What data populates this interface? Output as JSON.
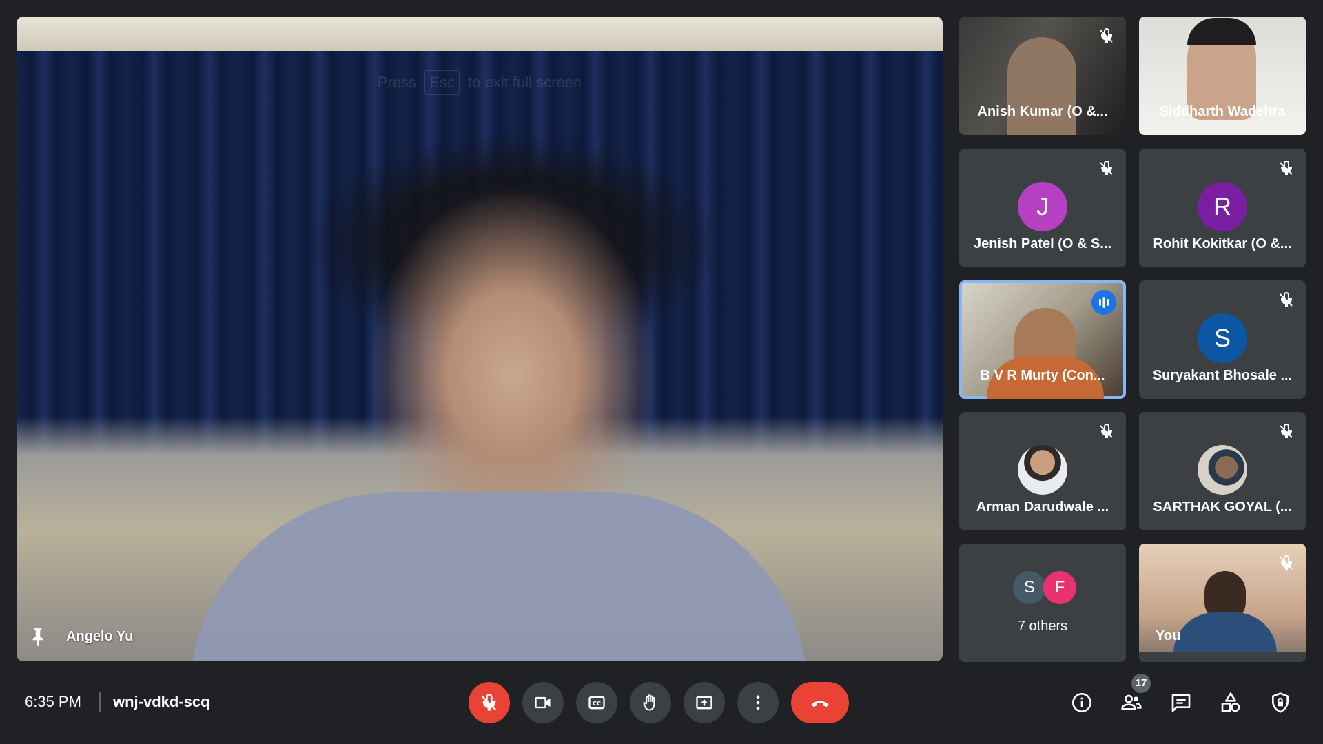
{
  "main": {
    "name": "Angelo Yu",
    "esc_hint_prefix": "Press",
    "esc_hint_key": "Esc",
    "esc_hint_suffix": "to exit full screen"
  },
  "participants": [
    {
      "name": "Anish Kumar (O &...",
      "type": "video",
      "muted": true
    },
    {
      "name": "Siddharth Wadehra",
      "type": "video",
      "muted": false
    },
    {
      "name": "Jenish Patel (O & S...",
      "type": "avatar",
      "initial": "J",
      "color": "#b541c2",
      "muted": true
    },
    {
      "name": "Rohit Kokitkar (O &...",
      "type": "avatar",
      "initial": "R",
      "color": "#7b1fa2",
      "muted": true
    },
    {
      "name": "B V R Murty (Con...",
      "type": "video",
      "muted": false,
      "speaking": true
    },
    {
      "name": "Suryakant Bhosale ...",
      "type": "avatar",
      "initial": "S",
      "color": "#0b57a4",
      "muted": true
    },
    {
      "name": "Arman Darudwale ...",
      "type": "photo",
      "muted": true
    },
    {
      "name": "SARTHAK GOYAL (...",
      "type": "photo",
      "muted": true
    },
    {
      "name": "You",
      "type": "video",
      "muted": true
    }
  ],
  "others": {
    "label": "7 others",
    "avatars": [
      {
        "initial": "S",
        "color": "#455a64"
      },
      {
        "initial": "F",
        "color": "#e8336f"
      }
    ]
  },
  "bottom_bar": {
    "time": "6:35 PM",
    "meeting_code": "wnj-vdkd-scq",
    "people_count": "17"
  },
  "colors": {
    "background": "#202124",
    "tile": "#3c4043",
    "danger": "#ea4335",
    "active_outline": "#8ab4f8"
  }
}
